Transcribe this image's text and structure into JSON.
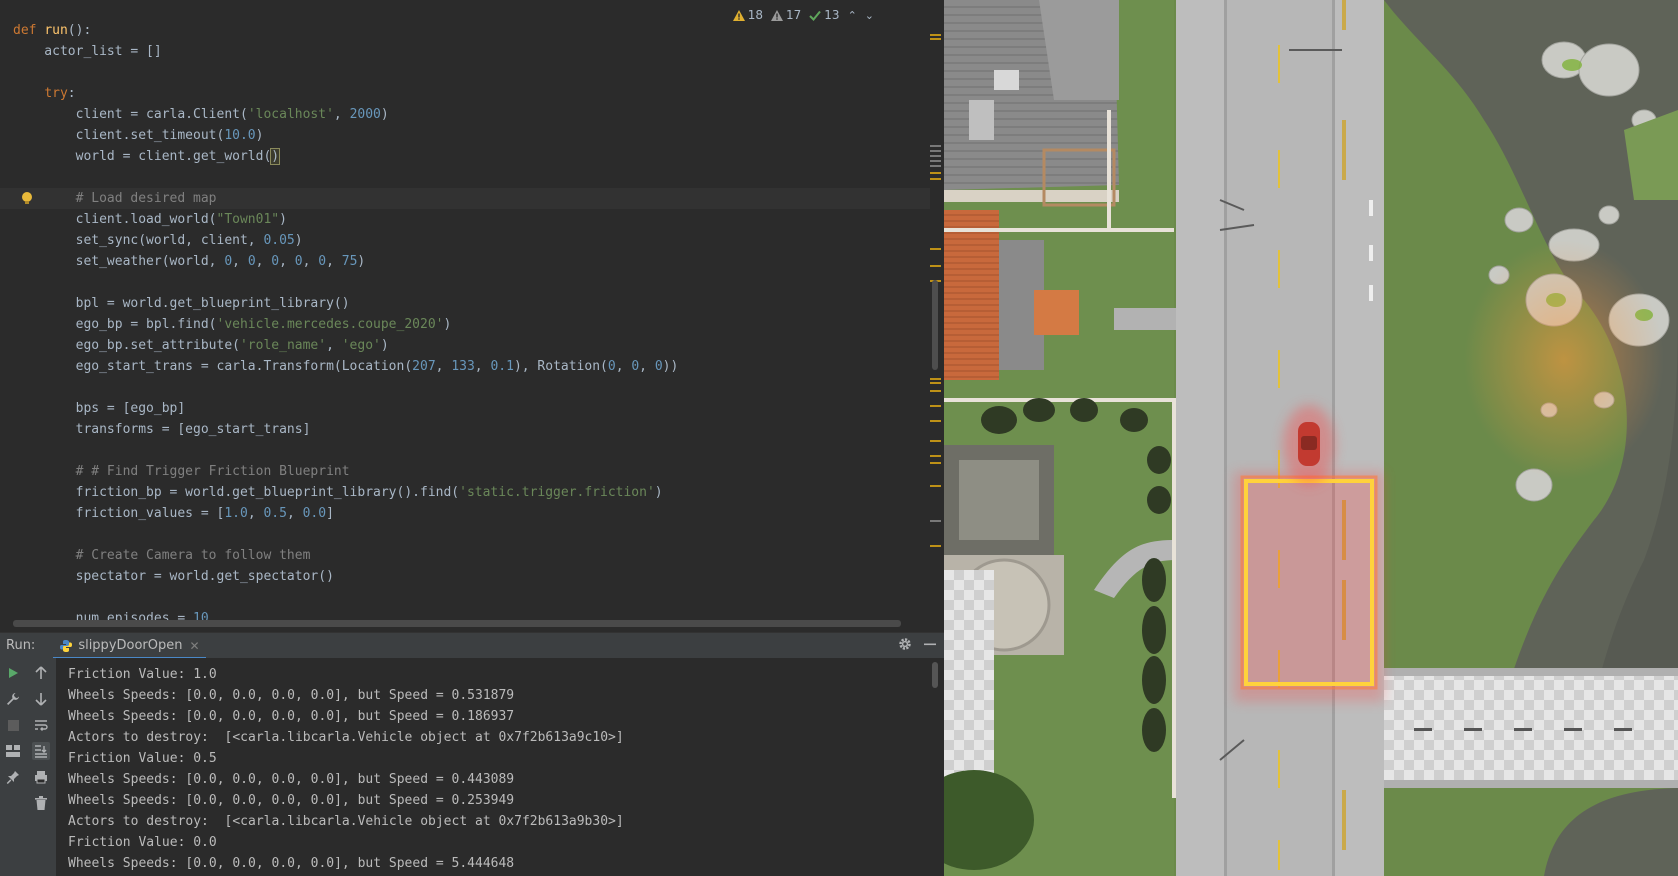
{
  "editor": {
    "inspections": {
      "warnings": "18",
      "weak_warnings": "17",
      "typos": "13"
    },
    "lines": [
      [
        [
          "kw",
          "def "
        ],
        [
          "fn",
          "run"
        ],
        [
          "t",
          "():"
        ]
      ],
      [
        [
          "t",
          "    actor_list = []"
        ]
      ],
      [
        [
          "t",
          ""
        ]
      ],
      [
        [
          "t",
          "    "
        ],
        [
          "kw",
          "try"
        ],
        [
          "t",
          ":"
        ]
      ],
      [
        [
          "t",
          "        client = carla.Client("
        ],
        [
          "str",
          "'localhost'"
        ],
        [
          "t",
          ", "
        ],
        [
          "num",
          "2000"
        ],
        [
          "t",
          ")"
        ]
      ],
      [
        [
          "t",
          "        client.set_timeout("
        ],
        [
          "num",
          "10.0"
        ],
        [
          "t",
          ")"
        ]
      ],
      [
        [
          "t",
          "        world = client.get_world("
        ],
        [
          "hl",
          ")"
        ]
      ],
      [
        [
          "t",
          ""
        ]
      ],
      [
        [
          "cmt",
          "        # Load desired map"
        ]
      ],
      [
        [
          "t",
          "        client.load_world("
        ],
        [
          "str",
          "\"Town01\""
        ],
        [
          "t",
          ")"
        ]
      ],
      [
        [
          "t",
          "        set_sync(world, client, "
        ],
        [
          "num",
          "0.05"
        ],
        [
          "t",
          ")"
        ]
      ],
      [
        [
          "t",
          "        set_weather(world, "
        ],
        [
          "num",
          "0"
        ],
        [
          "t",
          ", "
        ],
        [
          "num",
          "0"
        ],
        [
          "t",
          ", "
        ],
        [
          "num",
          "0"
        ],
        [
          "t",
          ", "
        ],
        [
          "num",
          "0"
        ],
        [
          "t",
          ", "
        ],
        [
          "num",
          "0"
        ],
        [
          "t",
          ", "
        ],
        [
          "num",
          "75"
        ],
        [
          "t",
          ")"
        ]
      ],
      [
        [
          "t",
          ""
        ]
      ],
      [
        [
          "t",
          "        bpl = world.get_blueprint_library()"
        ]
      ],
      [
        [
          "t",
          "        ego_bp = bpl.find("
        ],
        [
          "str",
          "'vehicle.mercedes.coupe_2020'"
        ],
        [
          "t",
          ")"
        ]
      ],
      [
        [
          "t",
          "        ego_bp.set_attribute("
        ],
        [
          "str",
          "'role_name'"
        ],
        [
          "t",
          ", "
        ],
        [
          "str",
          "'ego'"
        ],
        [
          "t",
          ")"
        ]
      ],
      [
        [
          "t",
          "        ego_start_trans = carla.Transform(Location("
        ],
        [
          "num",
          "207"
        ],
        [
          "t",
          ", "
        ],
        [
          "num",
          "133"
        ],
        [
          "t",
          ", "
        ],
        [
          "num",
          "0.1"
        ],
        [
          "t",
          "), Rotation("
        ],
        [
          "num",
          "0"
        ],
        [
          "t",
          ", "
        ],
        [
          "num",
          "0"
        ],
        [
          "t",
          ", "
        ],
        [
          "num",
          "0"
        ],
        [
          "t",
          "))"
        ]
      ],
      [
        [
          "t",
          ""
        ]
      ],
      [
        [
          "t",
          "        bps = [ego_bp]"
        ]
      ],
      [
        [
          "t",
          "        transforms = [ego_start_trans]"
        ]
      ],
      [
        [
          "t",
          ""
        ]
      ],
      [
        [
          "cmt",
          "        # # Find Trigger Friction Blueprint"
        ]
      ],
      [
        [
          "t",
          "        friction_bp = world.get_blueprint_library().find("
        ],
        [
          "str",
          "'static.trigger.friction'"
        ],
        [
          "t",
          ")"
        ]
      ],
      [
        [
          "t",
          "        friction_values = ["
        ],
        [
          "num",
          "1.0"
        ],
        [
          "t",
          ", "
        ],
        [
          "num",
          "0.5"
        ],
        [
          "t",
          ", "
        ],
        [
          "num",
          "0.0"
        ],
        [
          "t",
          "]"
        ]
      ],
      [
        [
          "t",
          ""
        ]
      ],
      [
        [
          "cmt",
          "        # Create Camera to follow them"
        ]
      ],
      [
        [
          "t",
          "        spectator = world.get_spectator()"
        ]
      ],
      [
        [
          "t",
          ""
        ]
      ],
      [
        [
          "t",
          "        num_episodes = "
        ],
        [
          "num",
          "10"
        ]
      ]
    ]
  },
  "run": {
    "label": "Run:",
    "tab_name": "slippyDoorOpen",
    "console_lines": [
      "Friction Value: 1.0",
      "Wheels Speeds: [0.0, 0.0, 0.0, 0.0], but Speed = 0.531879",
      "Wheels Speeds: [0.0, 0.0, 0.0, 0.0], but Speed = 0.186937",
      "Actors to destroy:  [<carla.libcarla.Vehicle object at 0x7f2b613a9c10>]",
      "Friction Value: 0.5",
      "Wheels Speeds: [0.0, 0.0, 0.0, 0.0], but Speed = 0.443089",
      "Wheels Speeds: [0.0, 0.0, 0.0, 0.0], but Speed = 0.253949",
      "Actors to destroy:  [<carla.libcarla.Vehicle object at 0x7f2b613a9b30>]",
      "Friction Value: 0.0",
      "Wheels Speeds: [0.0, 0.0, 0.0, 0.0], but Speed = 5.444648"
    ]
  },
  "colors": {
    "editor_bg": "#2b2b2b",
    "panel_bg": "#3c3f41",
    "keyword": "#cc7832",
    "function": "#ffc66d",
    "string": "#6a8759",
    "number": "#6897bb",
    "comment": "#808080",
    "friction_box": "#ffd23c"
  }
}
